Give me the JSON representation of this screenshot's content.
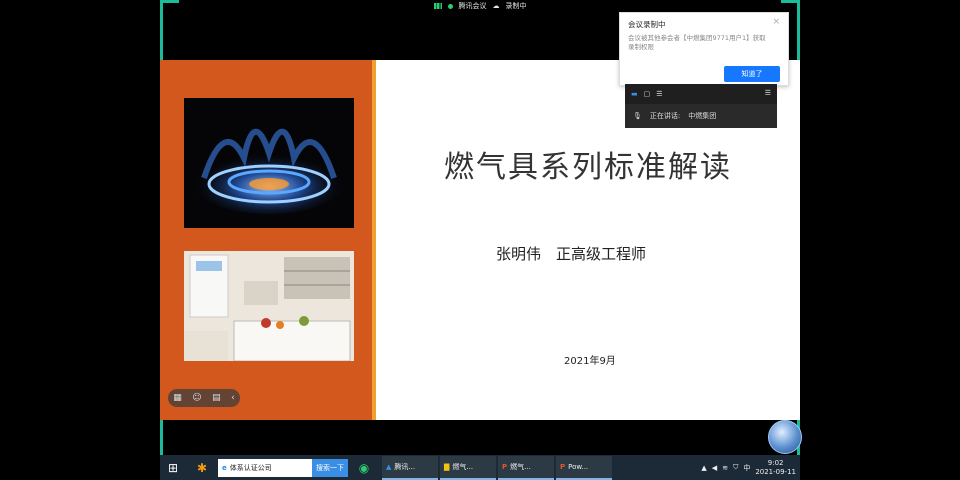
{
  "meeting_bar": {
    "app": "腾讯会议",
    "recording": "录制中"
  },
  "slide": {
    "title": "燃气具系列标准解读",
    "author": "张明伟　正高级工程师",
    "date": "2021年9月"
  },
  "slide_toolbar": {
    "collapse": "‹"
  },
  "notice": {
    "title": "会议录制中",
    "close": "×",
    "body": "会议被其他参会者【中燃集团9771用户1】获取录制权限",
    "ok_label": "知道了"
  },
  "speaking": {
    "label": "正在讲话:",
    "name": "中燃集团"
  },
  "taskbar": {
    "search_value": "体系认证公司",
    "search_button": "搜索一下",
    "apps": [
      "腾讯...",
      "燃气...",
      "燃气...",
      "Pow..."
    ],
    "tray_ime": "中",
    "time": "9:02",
    "date": "2021-09-11"
  },
  "colors": {
    "slide_left": "#d2581d",
    "accent": "#1abc9c",
    "taskbar": "#1b2a36"
  }
}
